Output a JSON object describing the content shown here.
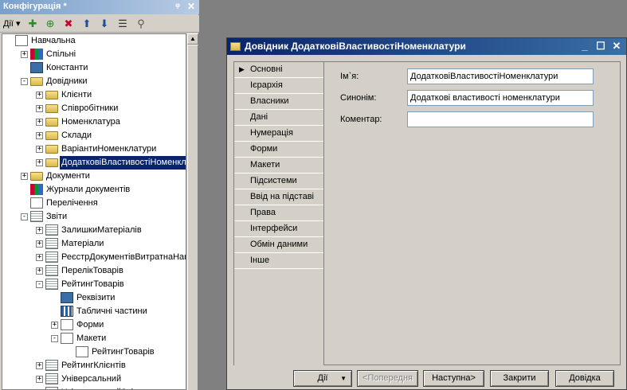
{
  "config_panel": {
    "title": "Конфігурація *",
    "pin_glyph": "ᵠ",
    "close_glyph": "✕",
    "actions_label": "Дії",
    "toolbar_icons": [
      "add-icon",
      "add-child-icon",
      "delete-icon",
      "move-up-icon",
      "move-down-icon",
      "sort-icon",
      "filter-icon"
    ]
  },
  "tree": {
    "rows": [
      {
        "label": "Навчальна",
        "indent": 0,
        "expander": "",
        "icon": "doc"
      },
      {
        "label": "Спільні",
        "indent": 1,
        "expander": "+",
        "icon": "multi"
      },
      {
        "label": "Константи",
        "indent": 1,
        "expander": "",
        "icon": "blue"
      },
      {
        "label": "Довідники",
        "indent": 1,
        "expander": "−",
        "icon": "folder"
      },
      {
        "label": "Клієнти",
        "indent": 2,
        "expander": "+",
        "icon": "folder"
      },
      {
        "label": "Співробітники",
        "indent": 2,
        "expander": "+",
        "icon": "folder"
      },
      {
        "label": "Номенклатура",
        "indent": 2,
        "expander": "+",
        "icon": "folder"
      },
      {
        "label": "Склади",
        "indent": 2,
        "expander": "+",
        "icon": "folder"
      },
      {
        "label": "ВаріантиНоменклатури",
        "indent": 2,
        "expander": "+",
        "icon": "folder"
      },
      {
        "label": "ДодатковіВластивостіНоменклатури",
        "indent": 2,
        "expander": "+",
        "icon": "folder",
        "selected": true
      },
      {
        "label": "Документи",
        "indent": 1,
        "expander": "+",
        "icon": "folder"
      },
      {
        "label": "Журнали документів",
        "indent": 1,
        "expander": "",
        "icon": "multi"
      },
      {
        "label": "Перелічення",
        "indent": 1,
        "expander": "",
        "icon": "doc"
      },
      {
        "label": "Звіти",
        "indent": 1,
        "expander": "−",
        "icon": "report"
      },
      {
        "label": "ЗалишкиМатеріалів",
        "indent": 2,
        "expander": "+",
        "icon": "report"
      },
      {
        "label": "Матеріали",
        "indent": 2,
        "expander": "+",
        "icon": "report"
      },
      {
        "label": "РеєстрДокументівВитратнаНакладна",
        "indent": 2,
        "expander": "+",
        "icon": "report"
      },
      {
        "label": "ПерелікТоварів",
        "indent": 2,
        "expander": "+",
        "icon": "report"
      },
      {
        "label": "РейтингТоварів",
        "indent": 2,
        "expander": "−",
        "icon": "report"
      },
      {
        "label": "Реквізити",
        "indent": 3,
        "expander": "",
        "icon": "blue"
      },
      {
        "label": "Табличні частини",
        "indent": 3,
        "expander": "",
        "icon": "table"
      },
      {
        "label": "Форми",
        "indent": 3,
        "expander": "+",
        "icon": "doc"
      },
      {
        "label": "Макети",
        "indent": 3,
        "expander": "−",
        "icon": "doc"
      },
      {
        "label": "РейтингТоварів",
        "indent": 4,
        "expander": "",
        "icon": "doc"
      },
      {
        "label": "РейтингКлієнтів",
        "indent": 2,
        "expander": "+",
        "icon": "report"
      },
      {
        "label": "Універсальний",
        "indent": 2,
        "expander": "+",
        "icon": "report"
      },
      {
        "label": "УніверсальнийЗвіт",
        "indent": 2,
        "expander": "+",
        "icon": "report"
      }
    ]
  },
  "dialog": {
    "title": "Довідник ДодатковіВластивостіНоменклатури",
    "minimize_glyph": "_",
    "maximize_glyph": "☐",
    "close_glyph": "✕",
    "tabs": [
      {
        "label": "Основні",
        "active": true
      },
      {
        "label": "Ієрархія"
      },
      {
        "label": "Власники"
      },
      {
        "label": "Дані"
      },
      {
        "label": "Нумерація"
      },
      {
        "label": "Форми"
      },
      {
        "label": "Макети"
      },
      {
        "label": "Підсистеми"
      },
      {
        "label": "Ввід на підставі"
      },
      {
        "label": "Права"
      },
      {
        "label": "Інтерфейси"
      },
      {
        "label": "Обмін даними"
      },
      {
        "label": "Інше"
      }
    ],
    "fields": {
      "name_label": "Ім`я:",
      "name_value": "ДодатковіВластивостіНоменклатури",
      "synonym_label": "Синонім:",
      "synonym_value": "Додаткові властивості номенклатури",
      "comment_label": "Коментар:",
      "comment_value": ""
    },
    "buttons": {
      "actions": "Дії",
      "previous": "<Попередня",
      "next": "Наступна>",
      "close": "Закрити",
      "help": "Довідка"
    }
  }
}
